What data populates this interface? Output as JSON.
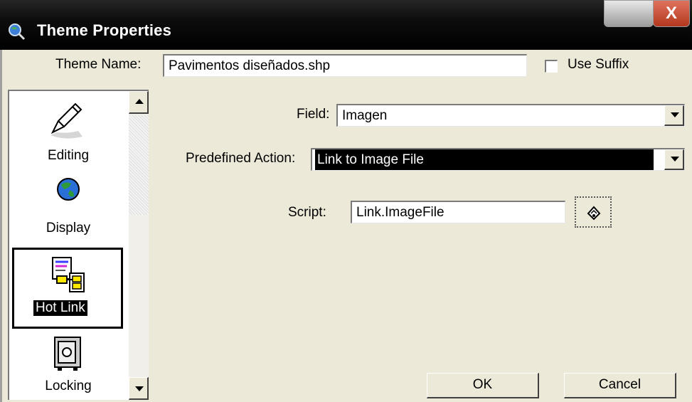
{
  "window": {
    "title": "Theme Properties",
    "close_label": "X"
  },
  "header": {
    "theme_name_label": "Theme Name:",
    "theme_name_value": "Pavimentos diseñados.shp",
    "use_suffix_label": "Use Suffix",
    "use_suffix_checked": false
  },
  "sidebar": {
    "items": [
      {
        "label": "Editing",
        "icon": "pencil-icon"
      },
      {
        "label": "Display",
        "icon": "globe-icon"
      },
      {
        "label": "Hot Link",
        "icon": "hotlink-icon",
        "selected": true
      },
      {
        "label": "Locking",
        "icon": "safe-icon"
      }
    ]
  },
  "form": {
    "field_label": "Field:",
    "field_value": "Imagen",
    "action_label": "Predefined Action:",
    "action_value": "Link to Image File",
    "script_label": "Script:",
    "script_value": "Link.ImageFile"
  },
  "buttons": {
    "ok": "OK",
    "cancel": "Cancel"
  },
  "colors": {
    "titlebar": "#000000",
    "dialog_bg": "#ece9d8",
    "selection": "#000000",
    "close_button": "#c9462d"
  }
}
